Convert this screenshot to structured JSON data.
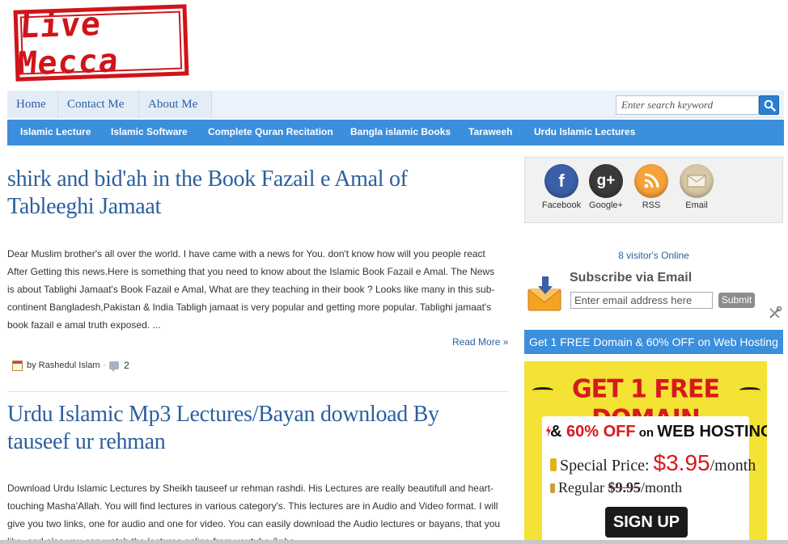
{
  "logo": {
    "text": "Live Mecca"
  },
  "top_nav": [
    {
      "label": "Home"
    },
    {
      "label": "Contact Me"
    },
    {
      "label": "About Me"
    }
  ],
  "search": {
    "placeholder": "Enter search keyword"
  },
  "categories": [
    {
      "label": "Islamic Lecture"
    },
    {
      "label": "Islamic Software"
    },
    {
      "label": "Complete Quran Recitation"
    },
    {
      "label": "Bangla islamic Books"
    },
    {
      "label": "Taraweeh"
    },
    {
      "label": "Urdu Islamic Lectures"
    }
  ],
  "posts": [
    {
      "title_line1": "shirk and bid'ah in the Book Fazail e Amal of",
      "title_line2": "Tableeghi Jamaat",
      "body_lines": [
        "Dear Muslim brother's all over the world. I have came with a news for You. don't know how will you people react",
        "After Getting this news.Here is something that you need to know about the Islamic Book Fazail e Amal. The News",
        "is about Tablighi Jamaat's Book Fazail e Amal, What are they teaching in their book ? Looks like many in this sub-",
        "continent Bangladesh,Pakistan & India Tabligh jamaat is very popular and getting more popular. Tablighi jamaat's",
        "book fazail e amal truth exposed. ..."
      ],
      "read_more": "Read More »",
      "author": "by Rashedul Islam",
      "separator": "·",
      "comments": "2"
    },
    {
      "title_line1": "Urdu Islamic Mp3 Lectures/Bayan download By",
      "title_line2": "tauseef ur rehman",
      "body_lines": [
        "Download Urdu Islamic Lectures by Sheikh tauseef ur rehman rashdi. His Lectures are really beautifull and heart-",
        "touching Masha'Allah. You will find lectures in various category's. This lectures are in Audio and Video format. I will",
        "give you two links, one for audio and one for video. You can easily download the Audio lectures or bayans, that you",
        "like, and also you can watch the lectures online from youtube &nbs..."
      ]
    }
  ],
  "social": [
    {
      "label": "Facebook",
      "glyph": "f",
      "color": "#3b5fa8",
      "icon": "facebook-icon"
    },
    {
      "label": "Google+",
      "glyph": "g+",
      "color": "#3a3a3a",
      "icon": "google-plus-icon"
    },
    {
      "label": "RSS",
      "glyph": "",
      "color": "#f5a23a",
      "icon": "rss-icon"
    },
    {
      "label": "Email",
      "glyph": "",
      "color": "#d7c8a6",
      "icon": "email-icon"
    }
  ],
  "visitors": "8 visitor's Online",
  "subscribe": {
    "title": "Subscribe via Email",
    "placeholder": "Enter email address here",
    "button": "Submit"
  },
  "domain_bar": "Get 1 FREE Domain & 60% OFF on Web Hosting",
  "ad": {
    "headline": "GET 1 FREE DOMAIN",
    "l1_amp": "& ",
    "l1_percent": "60% OFF",
    "l1_on": " on ",
    "l1_hosting": "WEB HOSTING",
    "l2_label": "Special Price: ",
    "l2_price": "$3.95",
    "l2_unit": "/month",
    "l3_label": "Regular ",
    "l3_price": "$9.95",
    "l3_unit": "/month",
    "button": "SIGN UP"
  }
}
